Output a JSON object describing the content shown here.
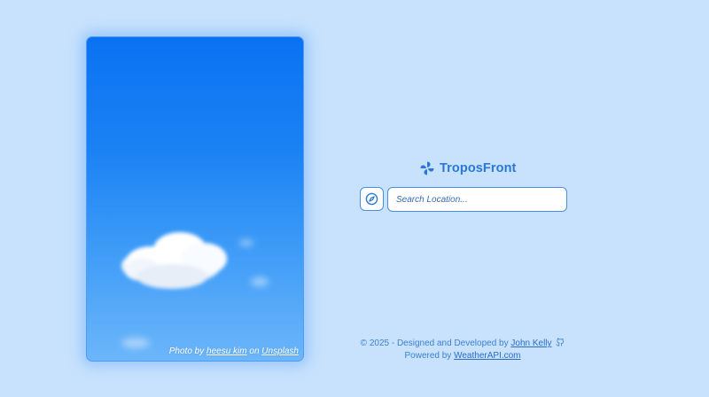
{
  "photo": {
    "credit_prefix": "Photo by",
    "photographer": "heesu kim",
    "credit_middle": "on",
    "source": "Unsplash"
  },
  "brand": {
    "name": "TroposFront",
    "icon": "pinwheel-icon",
    "color": "#2a78d4"
  },
  "search": {
    "locate_icon": "compass-icon",
    "placeholder": "Search Location...",
    "value": ""
  },
  "footer": {
    "copyright_prefix": "© 2025 - Designed and Developed by",
    "author": "John Kelly",
    "author_icon": "github-icon",
    "powered_prefix": "Powered by",
    "provider": "WeatherAPI.com"
  },
  "colors": {
    "background": "#c8e2fd",
    "accent": "#4a8ee0",
    "sky_top": "#0a72f2",
    "sky_bottom": "#6cb6fa"
  }
}
